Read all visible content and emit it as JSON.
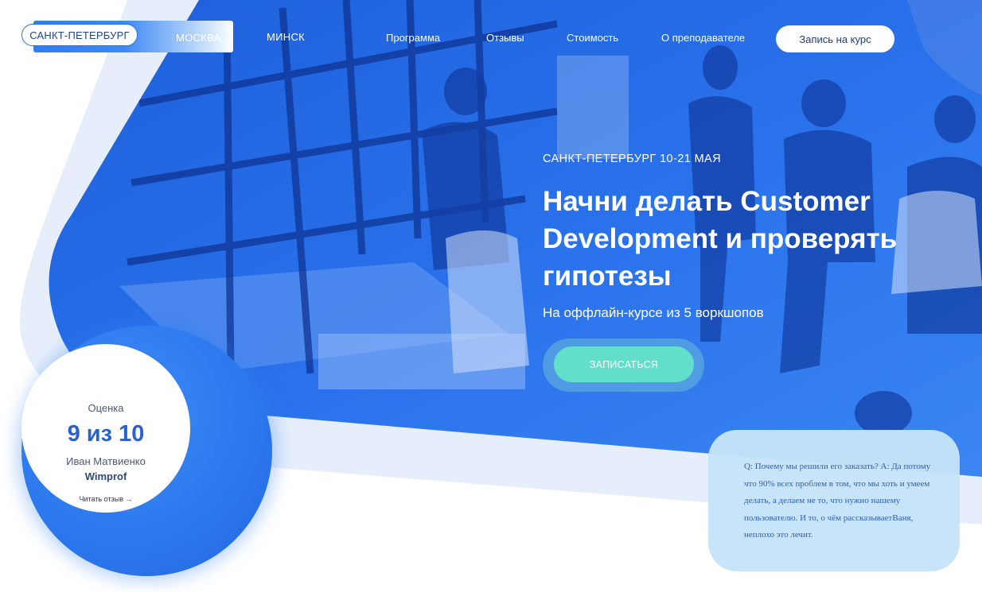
{
  "colors": {
    "primary_blue": "#2f7df3",
    "deep_blue": "#1f58d6",
    "accent_teal": "#61dfcb",
    "quote_bg": "#c5e3f8",
    "pale_band": "#e6eefb"
  },
  "header": {
    "cities": {
      "selected": "САНКТ-ПЕТЕРБУРГ",
      "others": [
        "МОСКВА",
        "МИНСК"
      ]
    },
    "nav": [
      "Программа",
      "Отзывы",
      "Стоимость",
      "О преподавателе"
    ],
    "cta_label": "Запись на курс"
  },
  "hero": {
    "eyebrow": "САНКТ-ПЕТЕРБУРГ 10-21 МАЯ",
    "title": "Начни делать Customer Development и проверять гипотезы",
    "subtitle": "На оффлайн-курсе из 5 воркшопов",
    "button_label": "ЗАПИСАТЬСЯ"
  },
  "rating": {
    "caption": "Оценка",
    "score": "9 из 10",
    "author": "Иван Матвиенко",
    "company": "Wimprof",
    "read_link": "Читать отзыв →"
  },
  "quote": {
    "text": "Q: Почему мы решили его заказать? А: Да потому что 90% всех проблем в том, что мы хоть и умеем делать, а делаем не то, что нужно нашему пользователю. И то, о чём рассказываетВаня, неплохо это лечит."
  }
}
